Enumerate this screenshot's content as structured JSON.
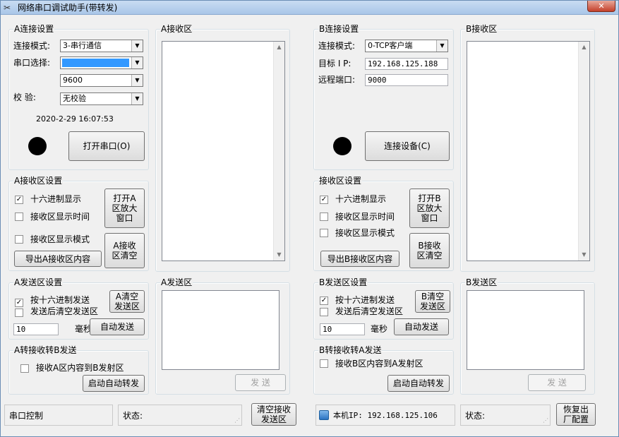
{
  "window": {
    "title": "网络串口调试助手(带转发)",
    "close_label": "✕"
  },
  "a_conn": {
    "title": "A连接设置",
    "mode_label": "连接模式:",
    "mode_value": "3-串行通信",
    "port_label": "串口选择:",
    "port_value": "",
    "baud_value": "9600",
    "parity_label": "校    验:",
    "parity_value": "无校验",
    "timestamp": "2020-2-29 16:07:53",
    "open_button": "打开串口(O)"
  },
  "a_recv": {
    "title": "A接收区"
  },
  "a_recv_settings": {
    "title": "A接收区设置",
    "hex_display": "十六进制显示",
    "hex_checked": true,
    "show_time": "接收区显示时间",
    "show_time_checked": false,
    "show_mode": "接收区显示模式",
    "show_mode_checked": false,
    "enlarge_button": "打开A区放大窗口",
    "clear_button": "A接收区清空",
    "export_button": "导出A接收区内容"
  },
  "a_send_settings": {
    "title": "A发送区设置",
    "hex_send": "按十六进制发送",
    "hex_send_checked": true,
    "clear_after": "发送后清空发送区",
    "clear_after_checked": false,
    "clear_button": "A清空发送区",
    "interval_value": "10",
    "interval_unit": "毫秒",
    "auto_send": "自动发送"
  },
  "a_to_b": {
    "title": "A转接收转B发送",
    "check_label": "接收A区内容到B发射区",
    "checked": false,
    "start_button": "启动自动转发"
  },
  "a_send": {
    "title": "A发送区",
    "send_button": "发 送"
  },
  "b_conn": {
    "title": "B连接设置",
    "mode_label": "连接模式:",
    "mode_value": "0-TCP客户端",
    "ip_label": "目标 I P:",
    "ip_value": "192.168.125.188",
    "port_label": "远程端口:",
    "port_value": "9000",
    "connect_button": "连接设备(C)"
  },
  "b_recv": {
    "title": "B接收区"
  },
  "b_recv_settings": {
    "title": "接收区设置",
    "hex_display": "十六进制显示",
    "hex_checked": true,
    "show_time": "接收区显示时间",
    "show_time_checked": false,
    "show_mode": "接收区显示模式",
    "show_mode_checked": false,
    "enlarge_button": "打开B区放大窗口",
    "clear_button": "B接收区清空",
    "export_button": "导出B接收区内容"
  },
  "b_send_settings": {
    "title": "B发送区设置",
    "hex_send": "按十六进制发送",
    "hex_send_checked": true,
    "clear_after": "发送后清空发送区",
    "clear_after_checked": false,
    "clear_button": "B清空发送区",
    "interval_value": "10",
    "interval_unit": "毫秒",
    "auto_send": "自动发送"
  },
  "b_to_a": {
    "title": "B转接收转A发送",
    "check_label": "接收B区内容到A发射区",
    "checked": false,
    "start_button": "启动自动转发"
  },
  "b_send": {
    "title": "B发送区",
    "send_button": "发 送"
  },
  "statusbar": {
    "left": "串口控制",
    "status_left": "状态:",
    "clear_button": "清空接收发送区",
    "local_ip": "本机IP: 192.168.125.106",
    "status_right": "状态:",
    "reset_button": "恢复出厂配置"
  }
}
